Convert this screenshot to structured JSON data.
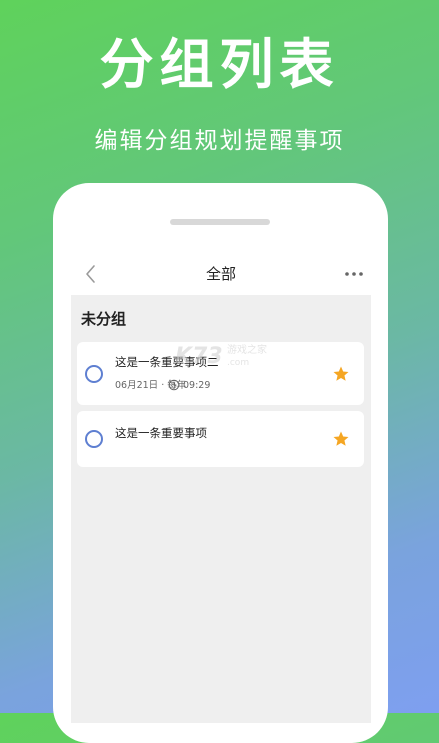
{
  "hero": {
    "title": "分组列表",
    "subtitle": "编辑分组规划提醒事项"
  },
  "nav": {
    "title": "全部",
    "back_icon": "chevron-left-icon",
    "more_icon": "more-horizontal-icon"
  },
  "group": {
    "title": "未分组"
  },
  "todos": [
    {
      "title": "这是一条重要事项二",
      "date": "06月21日 · 每年",
      "time": "09:29",
      "starred": true
    },
    {
      "title": "这是一条重要事项",
      "starred": true
    }
  ],
  "watermark": {
    "logo": "K73",
    "text": "游戏之家",
    "url": ".com"
  },
  "colors": {
    "accent_radio": "#5e7fd1",
    "star": "#f5a623",
    "gradient_top": "#5fd25b",
    "gradient_bottom": "#7e9ff0"
  }
}
